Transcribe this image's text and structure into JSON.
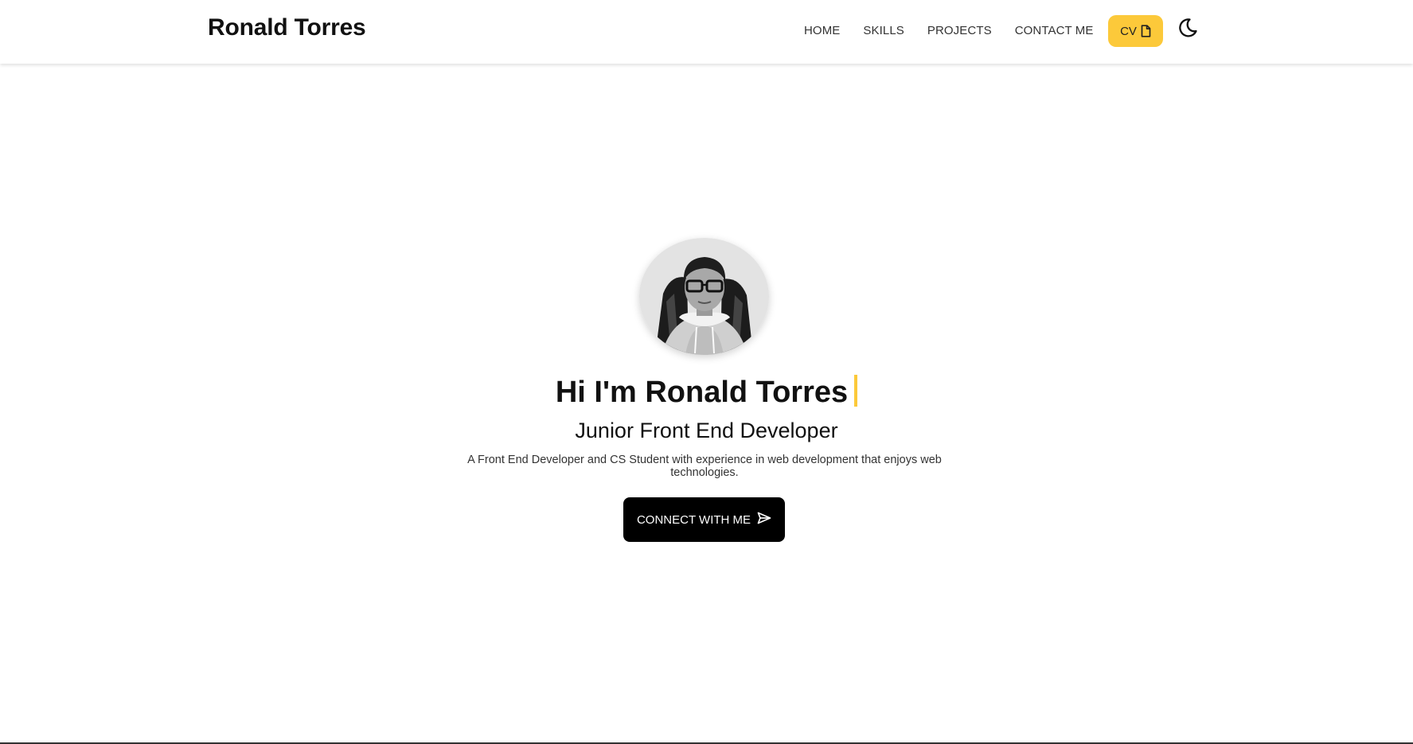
{
  "header": {
    "brand": "Ronald Torres",
    "nav": [
      {
        "label": "HOME"
      },
      {
        "label": "SKILLS"
      },
      {
        "label": "PROJECTS"
      },
      {
        "label": "CONTACT ME"
      }
    ],
    "cv_label": "CV",
    "cv_icon": "file-icon",
    "theme_icon": "moon-icon"
  },
  "hero": {
    "title": "Hi I'm Ronald Torres",
    "subtitle": "Junior Front End Developer",
    "description": "A Front End Developer and CS Student with experience in web development that enjoys web technologies.",
    "cta_label": "CONNECT WITH ME",
    "cta_icon": "send-icon"
  },
  "colors": {
    "accent": "#fcc93a",
    "button_dark": "#000000",
    "text": "#111111",
    "background": "#ffffff"
  }
}
